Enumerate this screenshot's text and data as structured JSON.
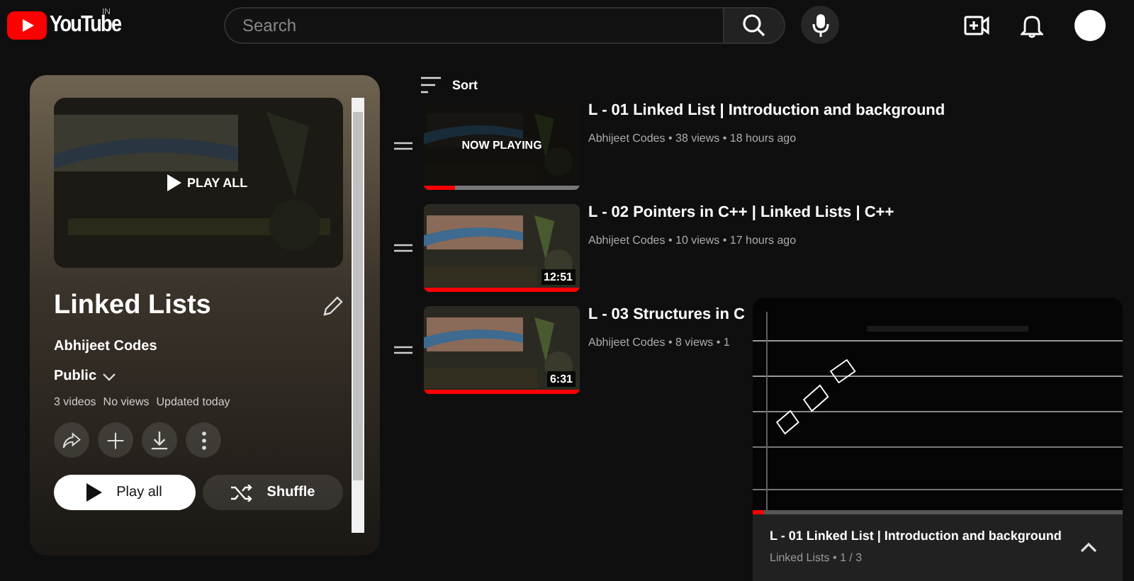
{
  "header": {
    "logo_text": "YouTube",
    "region": "IN",
    "search": {
      "placeholder": "Search"
    }
  },
  "playlist": {
    "thumbnail_overlay": "PLAY ALL",
    "title": "Linked Lists",
    "owner": "Abhijeet Codes",
    "visibility": "Public",
    "stats": [
      "3 videos",
      "No views",
      "Updated today"
    ],
    "buttons": [
      {
        "kind": "play",
        "label": "Play all"
      },
      {
        "kind": "shuffle",
        "label": "Shuffle"
      }
    ]
  },
  "sort_label": "Sort",
  "videos": [
    {
      "title": "L - 01 Linked List | Introduction and background",
      "meta": "Abhijeet Codes • 38 views • 18 hours ago",
      "overlay": "NOW PLAYING",
      "level": 0.2,
      "selected": true
    },
    {
      "title": "L - 02 Pointers in C++ | Linked Lists | C++",
      "meta": "Abhijeet Codes • 10 views • 17 hours ago",
      "duration": "12:51",
      "level": 1,
      "selected": false
    },
    {
      "title": "L - 03 Structures in C",
      "meta": "Abhijeet Codes • 8 views • 1",
      "duration": "6:31",
      "level": 1,
      "selected": false
    }
  ],
  "miniplayer": {
    "level": 0.03,
    "title": "L - 01 Linked List | Introduction and background",
    "subtitle": "Linked Lists • 1 / 3"
  }
}
